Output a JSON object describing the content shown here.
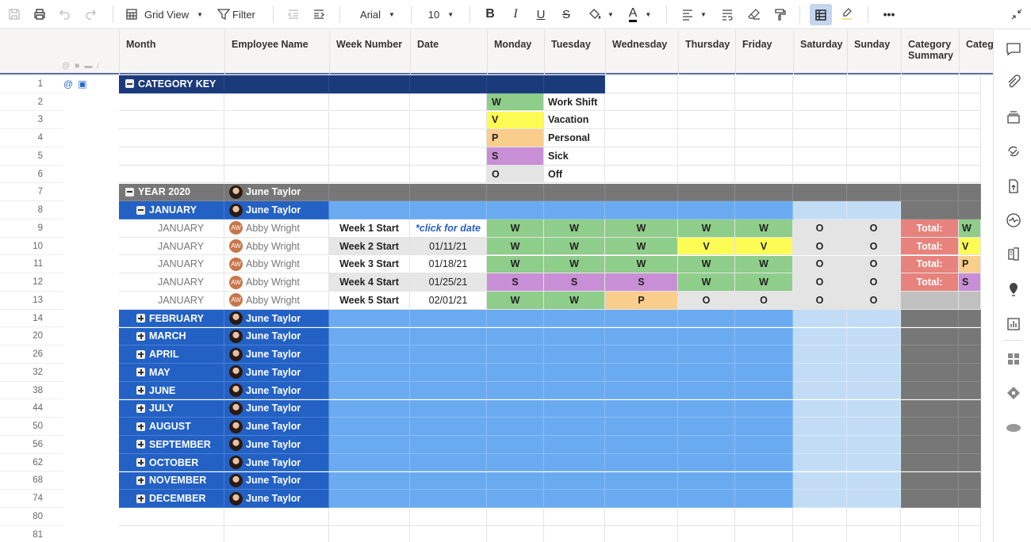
{
  "toolbar": {
    "view_label": "Grid View",
    "filter_label": "Filter",
    "font": "Arial",
    "font_size": "10"
  },
  "columns": [
    "Month",
    "Employee Name",
    "Week Number",
    "Date",
    "Monday",
    "Tuesday",
    "Wednesday",
    "Thursday",
    "Friday",
    "Saturday",
    "Sunday",
    "Category Summary",
    "Categ"
  ],
  "colors": {
    "navy": "#1a3a7a",
    "blue": "#2361c4",
    "lightblue": "#6aaaf0",
    "paleblue": "#c2dcf6",
    "gray": "#777777",
    "W": "#8fcd8a",
    "V": "#fdfc55",
    "P": "#f9cd8c",
    "S": "#c98fd6",
    "O": "#e4e4e4",
    "total": "#e7827c"
  },
  "key": {
    "title": "CATEGORY KEY",
    "items": [
      {
        "code": "W",
        "label": "Work Shift"
      },
      {
        "code": "V",
        "label": "Vacation"
      },
      {
        "code": "P",
        "label": "Personal"
      },
      {
        "code": "S",
        "label": "Sick"
      },
      {
        "code": "O",
        "label": "Off"
      }
    ]
  },
  "year": {
    "label": "YEAR 2020",
    "owner": "June Taylor"
  },
  "january": {
    "label": "JANUARY",
    "owner": "June Taylor"
  },
  "weeks": [
    {
      "row": "9",
      "month": "JANUARY",
      "initials": "AW",
      "name": "Abby Wright",
      "week": "Week 1 Start",
      "date": "*click for date",
      "days": [
        "W",
        "W",
        "W",
        "W",
        "W",
        "O",
        "O"
      ],
      "total": "Total:",
      "cat": "W"
    },
    {
      "row": "10",
      "month": "JANUARY",
      "initials": "AW",
      "name": "Abby Wright",
      "week": "Week 2 Start",
      "date": "01/11/21",
      "days": [
        "W",
        "W",
        "W",
        "V",
        "V",
        "O",
        "O"
      ],
      "total": "Total:",
      "cat": "V"
    },
    {
      "row": "11",
      "month": "JANUARY",
      "initials": "AW",
      "name": "Abby Wright",
      "week": "Week 3 Start",
      "date": "01/18/21",
      "days": [
        "W",
        "W",
        "W",
        "W",
        "W",
        "O",
        "O"
      ],
      "total": "Total:",
      "cat": "P"
    },
    {
      "row": "12",
      "month": "JANUARY",
      "initials": "AW",
      "name": "Abby Wright",
      "week": "Week 4 Start",
      "date": "01/25/21",
      "days": [
        "S",
        "S",
        "S",
        "W",
        "W",
        "O",
        "O"
      ],
      "total": "Total:",
      "cat": "S"
    },
    {
      "row": "13",
      "month": "JANUARY",
      "initials": "AW",
      "name": "Abby Wright",
      "week": "Week 5 Start",
      "date": "02/01/21",
      "days": [
        "W",
        "W",
        "P",
        "O",
        "O",
        "O",
        "O"
      ],
      "total": "",
      "cat": ""
    }
  ],
  "months": [
    {
      "row": "14",
      "label": "FEBRUARY",
      "owner": "June Taylor"
    },
    {
      "row": "20",
      "label": "MARCH",
      "owner": "June Taylor"
    },
    {
      "row": "26",
      "label": "APRIL",
      "owner": "June Taylor"
    },
    {
      "row": "32",
      "label": "MAY",
      "owner": "June Taylor"
    },
    {
      "row": "38",
      "label": "JUNE",
      "owner": "June Taylor"
    },
    {
      "row": "44",
      "label": "JULY",
      "owner": "June Taylor"
    },
    {
      "row": "50",
      "label": "AUGUST",
      "owner": "June Taylor"
    },
    {
      "row": "56",
      "label": "SEPTEMBER",
      "owner": "June Taylor"
    },
    {
      "row": "62",
      "label": "OCTOBER",
      "owner": "June Taylor"
    },
    {
      "row": "68",
      "label": "NOVEMBER",
      "owner": "June Taylor"
    },
    {
      "row": "74",
      "label": "DECEMBER",
      "owner": "June Taylor"
    }
  ],
  "empty_rows": [
    "80",
    "81"
  ]
}
